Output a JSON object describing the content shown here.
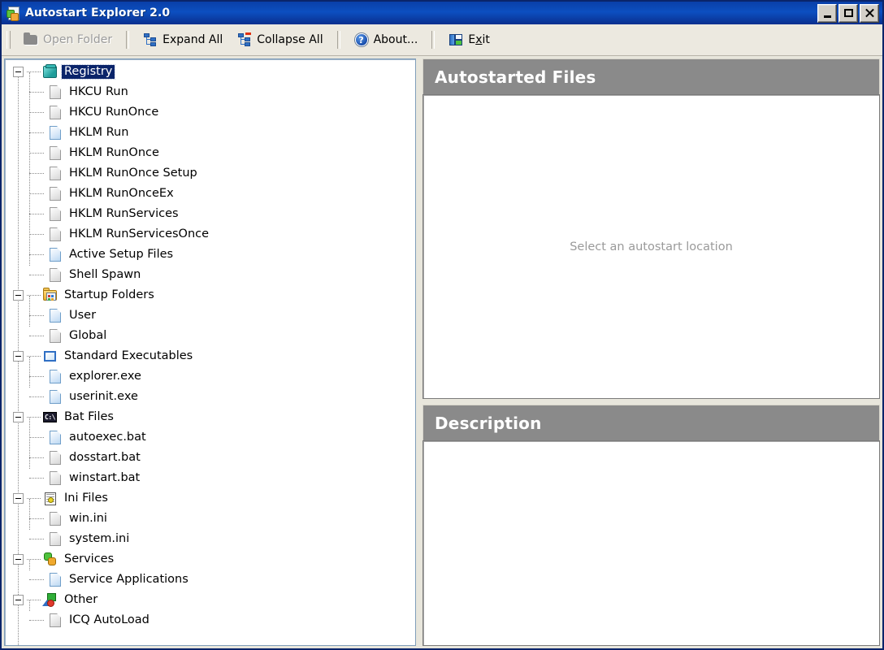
{
  "window": {
    "title": "Autostart Explorer 2.0",
    "app_icon": "app-document-puzzle-icon",
    "controls": {
      "minimize": "minimize-icon",
      "maximize": "maximize-icon",
      "close": "close-icon"
    }
  },
  "toolbar": {
    "buttons": [
      {
        "label": "Open Folder",
        "icon": "folder-icon",
        "enabled": false
      },
      {
        "label": "Expand All",
        "icon": "tree-expand-icon",
        "enabled": true
      },
      {
        "label": "Collapse All",
        "icon": "tree-collapse-icon",
        "enabled": true
      },
      {
        "label": "About...",
        "icon": "question-circle-icon",
        "enabled": true
      },
      {
        "label": "Exit",
        "icon": "exit-door-icon",
        "enabled": true,
        "accel": "x"
      }
    ]
  },
  "tree": {
    "groups": [
      {
        "label": "Registry",
        "icon": "registry-icon",
        "expanded": true,
        "selected": true,
        "children": [
          {
            "label": "HKCU Run",
            "icon": "file-icon",
            "state": "grey"
          },
          {
            "label": "HKCU RunOnce",
            "icon": "file-icon",
            "state": "grey"
          },
          {
            "label": "HKLM Run",
            "icon": "file-icon",
            "state": "blue"
          },
          {
            "label": "HKLM RunOnce",
            "icon": "file-icon",
            "state": "grey"
          },
          {
            "label": "HKLM RunOnce Setup",
            "icon": "file-icon",
            "state": "grey"
          },
          {
            "label": "HKLM RunOnceEx",
            "icon": "file-icon",
            "state": "grey"
          },
          {
            "label": "HKLM RunServices",
            "icon": "file-icon",
            "state": "grey"
          },
          {
            "label": "HKLM RunServicesOnce",
            "icon": "file-icon",
            "state": "grey"
          },
          {
            "label": "Active Setup Files",
            "icon": "file-icon",
            "state": "blue"
          },
          {
            "label": "Shell Spawn",
            "icon": "file-icon",
            "state": "grey"
          }
        ]
      },
      {
        "label": "Startup Folders",
        "icon": "startup-folder-icon",
        "expanded": true,
        "selected": false,
        "children": [
          {
            "label": "User",
            "icon": "file-icon",
            "state": "blue"
          },
          {
            "label": "Global",
            "icon": "file-icon",
            "state": "grey"
          }
        ]
      },
      {
        "label": "Standard Executables",
        "icon": "standard-executable-icon",
        "expanded": true,
        "selected": false,
        "children": [
          {
            "label": "explorer.exe",
            "icon": "file-icon",
            "state": "blue"
          },
          {
            "label": "userinit.exe",
            "icon": "file-icon",
            "state": "blue"
          }
        ]
      },
      {
        "label": "Bat Files",
        "icon": "console-icon",
        "icon_text": "C:\\",
        "expanded": true,
        "selected": false,
        "children": [
          {
            "label": "autoexec.bat",
            "icon": "file-icon",
            "state": "blue"
          },
          {
            "label": "dosstart.bat",
            "icon": "file-icon",
            "state": "grey"
          },
          {
            "label": "winstart.bat",
            "icon": "file-icon",
            "state": "grey"
          }
        ]
      },
      {
        "label": "Ini Files",
        "icon": "notepad-icon",
        "expanded": true,
        "selected": false,
        "children": [
          {
            "label": "win.ini",
            "icon": "file-icon",
            "state": "grey"
          },
          {
            "label": "system.ini",
            "icon": "file-icon",
            "state": "grey"
          }
        ]
      },
      {
        "label": "Services",
        "icon": "gears-icon",
        "expanded": true,
        "selected": false,
        "children": [
          {
            "label": "Service Applications",
            "icon": "file-icon",
            "state": "blue"
          }
        ]
      },
      {
        "label": "Other",
        "icon": "shapes-icon",
        "expanded": true,
        "selected": false,
        "children": [
          {
            "label": "ICQ AutoLoad",
            "icon": "file-icon",
            "state": "grey"
          }
        ]
      }
    ]
  },
  "panels": {
    "files": {
      "title": "Autostarted Files",
      "placeholder": "Select an autostart location"
    },
    "description": {
      "title": "Description",
      "placeholder": ""
    }
  },
  "colors": {
    "titlebar": "#0c4fc0",
    "selection": "#0a246a",
    "panel_header": "#8a8a8a",
    "window_bg": "#e8e6dc",
    "placeholder_text": "#9a9a9a"
  }
}
